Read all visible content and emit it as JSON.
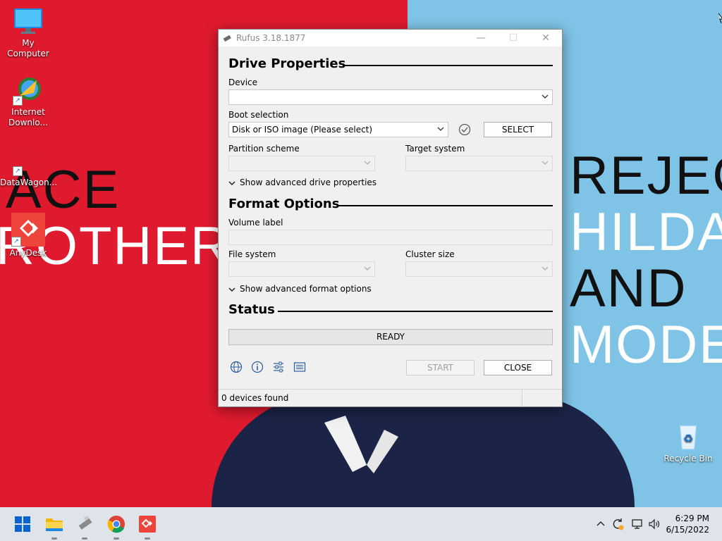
{
  "colors": {
    "wall_red": "#e01a2e",
    "wall_blue": "#7fc4e6",
    "accent_blue": "#0a64d2"
  },
  "wallpaper": {
    "left_line1": "ACE",
    "left_line2": "ROTHER",
    "right_line1": "REJEC",
    "right_line2": "HILDA",
    "right_line3": "AND",
    "right_line4": "MODE"
  },
  "desktop": {
    "icons": [
      {
        "label": "My Computer",
        "icon": "monitor-icon"
      },
      {
        "label": "Internet Downlo...",
        "icon": "internet-download-manager-icon"
      },
      {
        "label": "DataWagon...",
        "icon": "datawagon-icon"
      },
      {
        "label": "AnyDesk",
        "icon": "anydesk-icon"
      },
      {
        "label": "Recycle Bin",
        "icon": "recycle-bin-icon"
      }
    ]
  },
  "window": {
    "title": "Rufus 3.18.1877",
    "drive_properties": {
      "heading": "Drive Properties",
      "device_label": "Device",
      "device_value": "",
      "boot_selection_label": "Boot selection",
      "boot_selection_value": "Disk or ISO image (Please select)",
      "select_button": "SELECT",
      "partition_scheme_label": "Partition scheme",
      "target_system_label": "Target system",
      "advanced_toggle": "Show advanced drive properties"
    },
    "format_options": {
      "heading": "Format Options",
      "volume_label_label": "Volume label",
      "volume_label_value": "",
      "file_system_label": "File system",
      "cluster_size_label": "Cluster size",
      "advanced_toggle": "Show advanced format options"
    },
    "status": {
      "heading": "Status",
      "progress_text": "READY",
      "progress": 0
    },
    "buttons": {
      "start": "START",
      "close": "CLOSE"
    },
    "statusbar": {
      "text": "0 devices found"
    }
  },
  "taskbar": {
    "time": "6:29 PM",
    "date": "6/15/2022"
  }
}
